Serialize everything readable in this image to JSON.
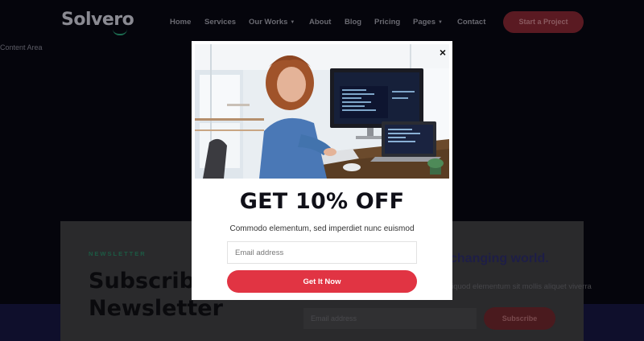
{
  "header": {
    "logo": "Solvero",
    "nav": [
      {
        "label": "Home",
        "caret": ""
      },
      {
        "label": "Services",
        "caret": ""
      },
      {
        "label": "Our Works",
        "caret": "▼"
      },
      {
        "label": "About",
        "caret": ""
      },
      {
        "label": "Blog",
        "caret": ""
      },
      {
        "label": "Pricing",
        "caret": ""
      },
      {
        "label": "Pages",
        "caret": "▼"
      },
      {
        "label": "Contact",
        "caret": ""
      }
    ],
    "cta_label": "Start a Project"
  },
  "content_area_label": "Content Area",
  "newsletter": {
    "kicker": "NEWSLETTER",
    "title": "Subscribe Our Newsletter",
    "heading_right": "changing world.",
    "description": "liquod elementum sit mollis aliquet viverra",
    "email_placeholder": "Email address",
    "subscribe_label": "Subscribe"
  },
  "popup": {
    "close_symbol": "×",
    "headline": "GET 10% OFF",
    "subtext": "Commodo elementum, sed imperdiet nunc euismod",
    "email_placeholder": "Email address",
    "cta_label": "Get It Now"
  },
  "colors": {
    "accent": "#e13443",
    "overlay_bg": "#05050c",
    "brand_green": "#1c6b50"
  }
}
